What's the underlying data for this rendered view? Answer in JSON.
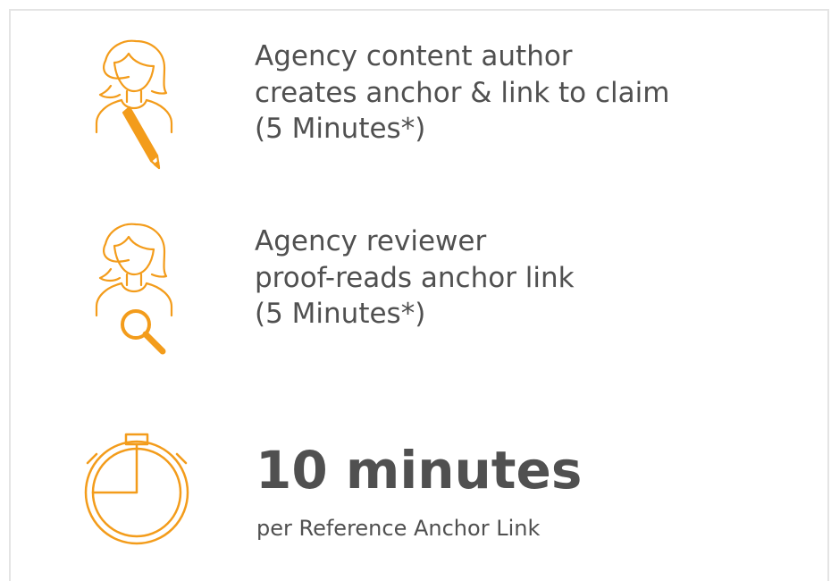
{
  "colors": {
    "accent": "#F39C1B",
    "text": "#505050",
    "frame": "#E4E4E4"
  },
  "steps": [
    {
      "icon": "person-with-pencil-icon",
      "lines": [
        "Agency content author",
        "creates anchor & link to claim",
        "(5 Minutes*)"
      ]
    },
    {
      "icon": "person-with-magnifier-icon",
      "lines": [
        "Agency reviewer",
        "proof-reads anchor link",
        "(5 Minutes*)"
      ]
    }
  ],
  "total": {
    "icon": "stopwatch-icon",
    "value": "10 minutes",
    "caption": "per Reference Anchor Link"
  }
}
